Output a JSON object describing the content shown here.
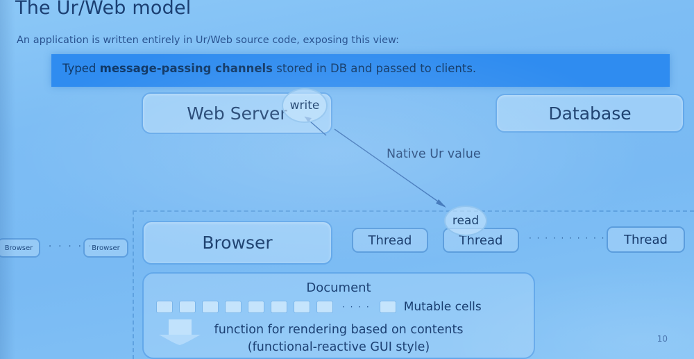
{
  "slide": {
    "title": "The Ur/Web model",
    "subtitle": "An application is written entirely in Ur/Web source code, exposing this view:",
    "page_number": "10"
  },
  "banner": {
    "prefix": "Typed ",
    "bold": "message-passing channels",
    "suffix": " stored in DB and passed to clients.",
    "color": "#2f8cf0"
  },
  "nodes": {
    "web_server": "Web Server",
    "database": "Database",
    "browser": "Browser",
    "mini_browser_1": "Browser",
    "mini_browser_2": "Browser",
    "browsers_ellipsis": "· · · · ·",
    "threads_ellipsis": "· · · · · · · · · ·",
    "threads": [
      "Thread",
      "Thread",
      "Thread"
    ]
  },
  "annotations": {
    "write": "write",
    "read": "read",
    "native_ur_value": "Native Ur value"
  },
  "document": {
    "title": "Document",
    "cells_ellipsis": "· · · ·",
    "mutable_cells_label": "Mutable cells",
    "render_line_1": "function for rendering based on contents",
    "render_line_2": "(functional-reactive GUI style)",
    "cell_count": 8
  },
  "colors": {
    "background": "#7dbdf4",
    "banner": "#2f8cf0",
    "box_border": "#63a8ea",
    "text": "#1b3f72"
  }
}
